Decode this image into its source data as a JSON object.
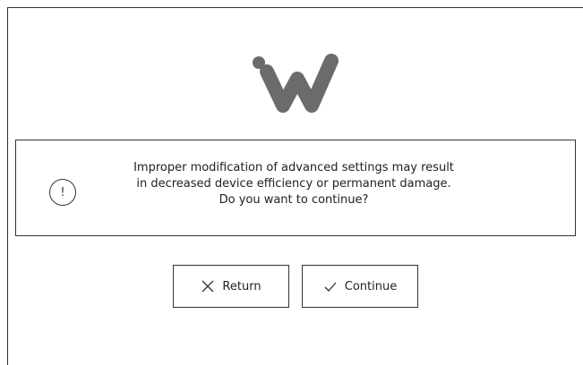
{
  "dialog": {
    "brand_logo": "w-logo",
    "warning": {
      "icon": "exclamation-circle-icon",
      "lines": [
        "Improper modification of advanced settings may result",
        "in decreased device efficiency or permanent damage.",
        "Do you want to continue?"
      ]
    },
    "buttons": {
      "return_label": "Return",
      "return_icon": "close-x-icon",
      "continue_label": "Continue",
      "continue_icon": "checkmark-icon"
    }
  },
  "colors": {
    "logo": "#6b6b6b",
    "border": "#333333",
    "text": "#222222",
    "background": "#ffffff"
  }
}
